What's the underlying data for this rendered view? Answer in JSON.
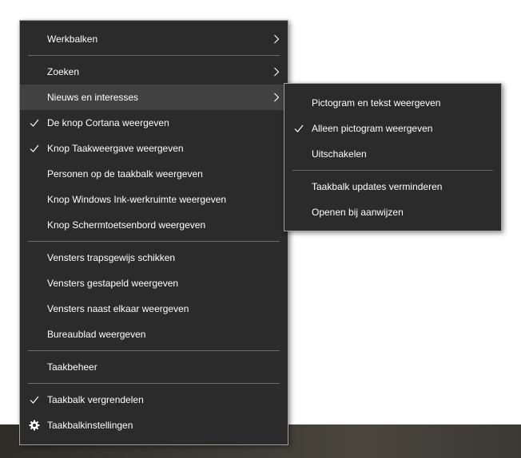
{
  "main_menu": {
    "toolbars": "Werkbalken",
    "search": "Zoeken",
    "news_interests": "Nieuws en interesses",
    "show_cortana": "De knop Cortana weergeven",
    "show_task_view": "Knop Taakweergave weergeven",
    "show_people": "Personen op de taakbalk weergeven",
    "show_ink": "Knop Windows Ink-werkruimte weergeven",
    "show_touch_keyboard": "Knop Schermtoetsenbord weergeven",
    "cascade_windows": "Vensters trapsgewijs schikken",
    "stack_windows": "Vensters gestapeld weergeven",
    "side_by_side": "Vensters naast elkaar weergeven",
    "show_desktop": "Bureaublad weergeven",
    "task_manager": "Taakbeheer",
    "lock_taskbar": "Taakbalk vergrendelen",
    "taskbar_settings": "Taakbalkinstellingen"
  },
  "sub_menu": {
    "icon_and_text": "Pictogram en tekst weergeven",
    "icon_only": "Alleen pictogram weergeven",
    "turn_off": "Uitschakelen",
    "reduce_updates": "Taakbalk updates verminderen",
    "open_on_hover": "Openen bij aanwijzen"
  },
  "colors": {
    "menu_bg": "#2b2b2b",
    "hover_bg": "#414141",
    "text": "#ffffff",
    "separator": "#6b6b6b"
  }
}
